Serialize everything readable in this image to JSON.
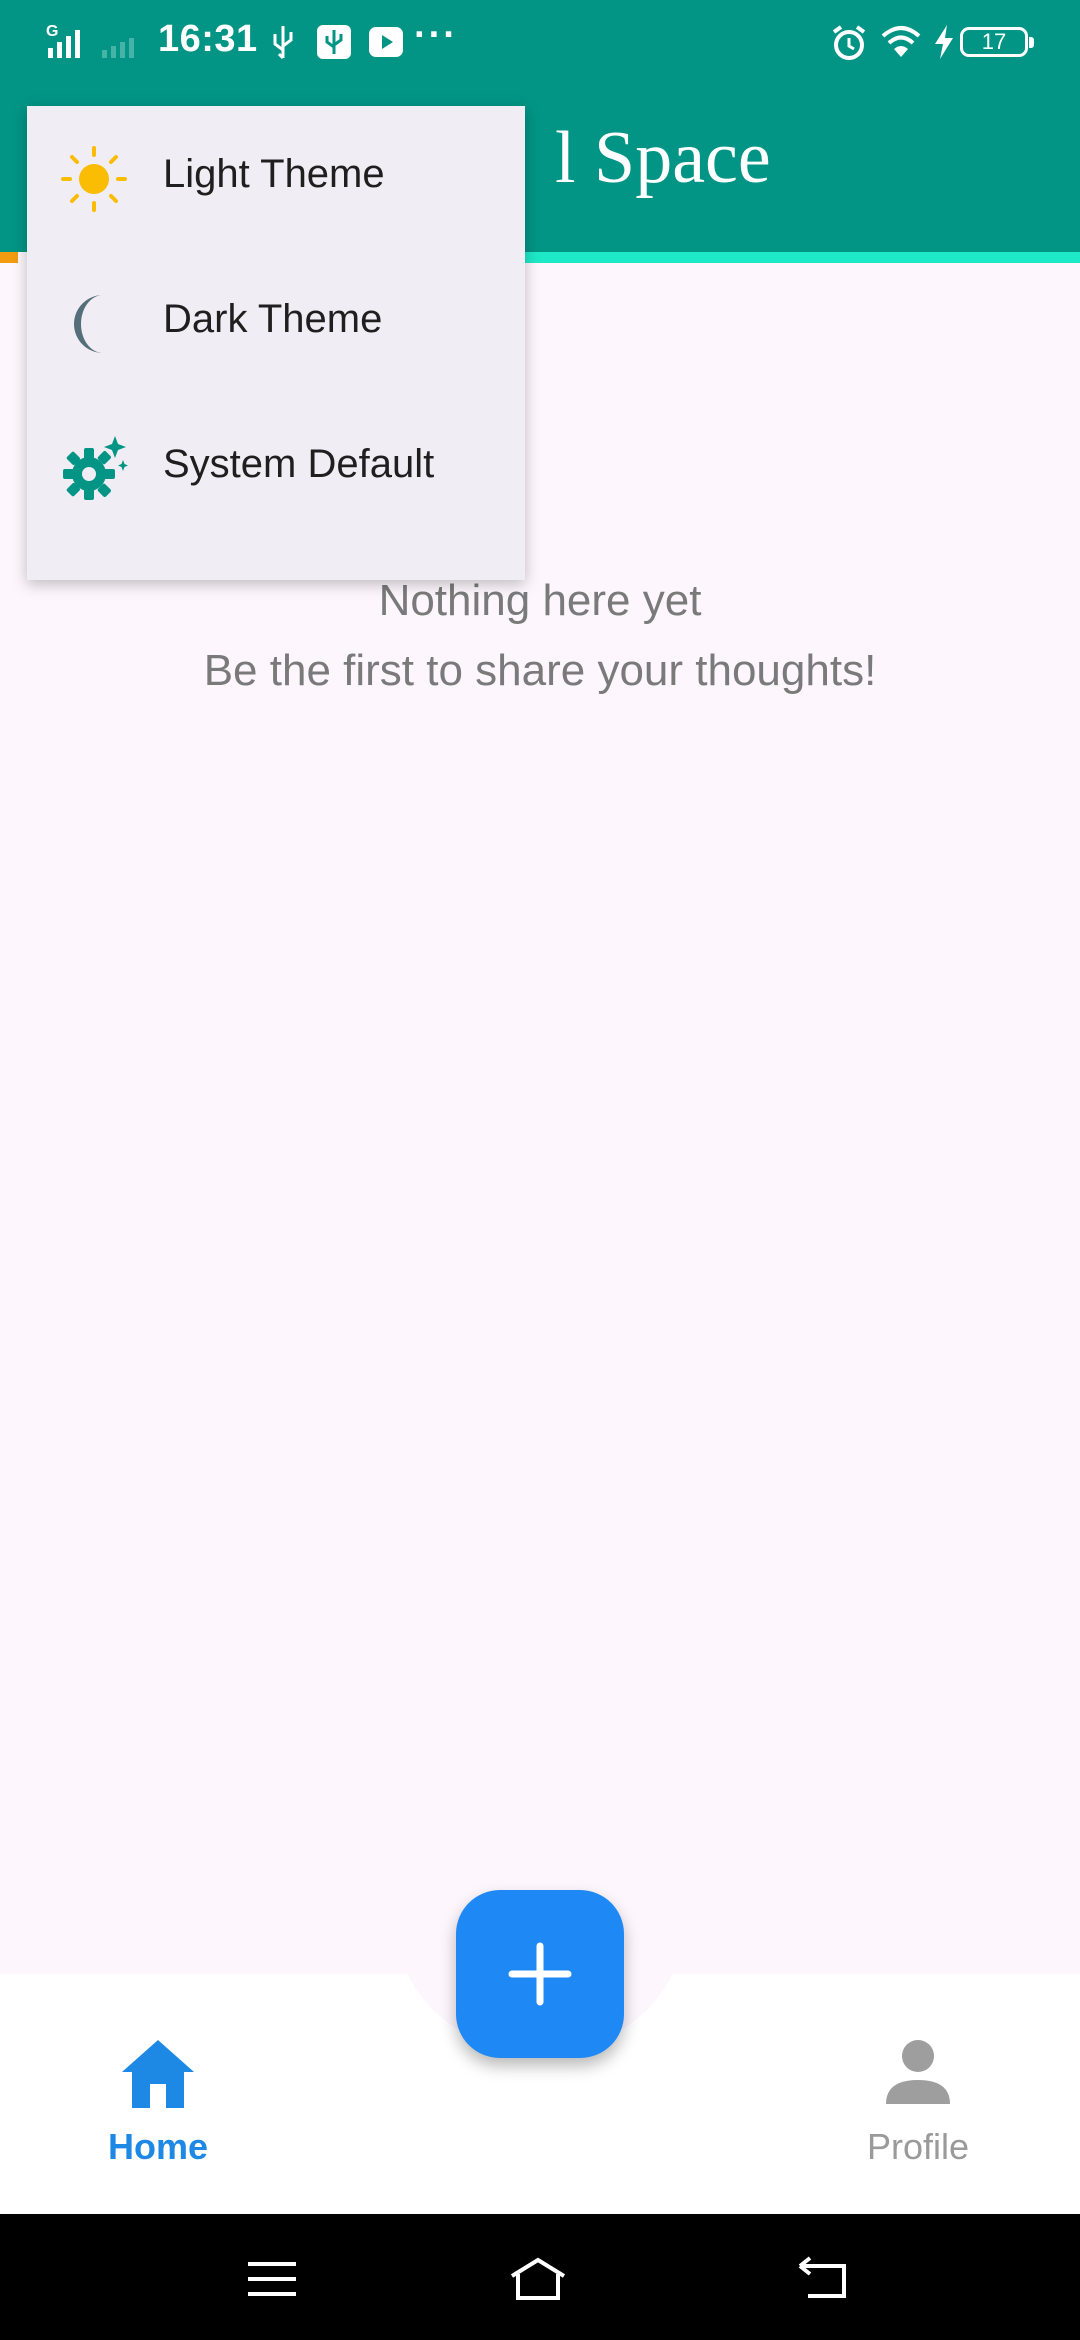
{
  "status_bar": {
    "network": "G",
    "time": "16:31",
    "overflow": "···",
    "battery": "17",
    "icons": [
      "signal-icon",
      "usb-icon",
      "usb-debug-icon",
      "youtube-icon",
      "alarm-icon",
      "wifi-icon",
      "charging-icon",
      "battery-icon"
    ]
  },
  "app_bar": {
    "title_visible": "l Space"
  },
  "theme_menu": {
    "items": [
      {
        "label": "Light Theme",
        "icon": "sun-icon",
        "color": "#fbbc04"
      },
      {
        "label": "Dark Theme",
        "icon": "moon-icon",
        "color": "#546e7a"
      },
      {
        "label": "System Default",
        "icon": "auto-settings-icon",
        "color": "#029585"
      }
    ]
  },
  "empty_state": {
    "title": "Nothing here yet",
    "subtitle": "Be the first to share your thoughts!"
  },
  "bottom_nav": {
    "items": [
      {
        "label": "Home",
        "icon": "home-icon",
        "active": true
      },
      {
        "label": "Profile",
        "icon": "person-icon",
        "active": false
      }
    ],
    "fab": {
      "icon": "plus-icon"
    }
  },
  "system_nav": {
    "buttons": [
      "menu-icon",
      "home-icon",
      "back-icon"
    ]
  },
  "colors": {
    "primary": "#029585",
    "accent": "#1de9c8",
    "fab": "#1e88f5",
    "nav_active": "#1e88e5",
    "background": "#fdf7fd"
  }
}
